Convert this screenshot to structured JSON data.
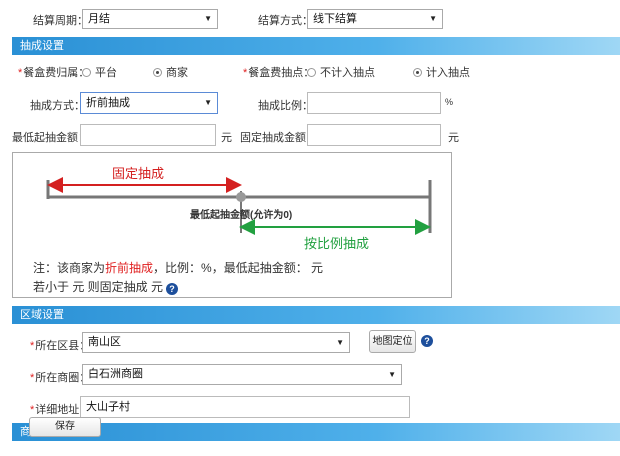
{
  "top": {
    "settle_period_label": "结算周期：",
    "settle_period_value": "月结",
    "settle_method_label": "结算方式：",
    "settle_method_value": "线下结算"
  },
  "commission": {
    "section_title": "抽成设置",
    "fee_owner_label": "餐盒费归属：",
    "fee_owner_options": [
      "平台",
      "商家"
    ],
    "fee_point_label": "餐盒费抽点：",
    "fee_point_options": [
      "不计入抽点",
      "计入抽点"
    ],
    "method_label": "抽成方式：",
    "method_value": "折前抽成",
    "ratio_label": "抽成比例：",
    "ratio_value": "",
    "ratio_unit": "%",
    "min_amount_label": "最低起抽金额：",
    "min_amount_value": "",
    "min_amount_unit": "元",
    "fixed_amount_label": "固定抽成金额：",
    "fixed_amount_value": "",
    "fixed_amount_unit": "元"
  },
  "diagram": {
    "fixed_label": "固定抽成",
    "min_label": "最低起抽金额(允许为0)",
    "ratio_label": "按比例抽成",
    "note_prefix": "注：该商家为",
    "note_method": "折前抽成",
    "note_suffix": "，比例：%，最低起抽金额： 元",
    "note_line2": "若小于 元 则固定抽成 元"
  },
  "region": {
    "section_title": "区域设置",
    "district_label": "所在区县：",
    "district_value": "南山区",
    "locate_button": "地图定位",
    "circle_label": "所在商圈：",
    "circle_value": "白石洲商圈",
    "address_label": "详细地址：",
    "address_value": "大山子村"
  },
  "footer": {
    "section_partial": "商",
    "save_button": "保存"
  }
}
